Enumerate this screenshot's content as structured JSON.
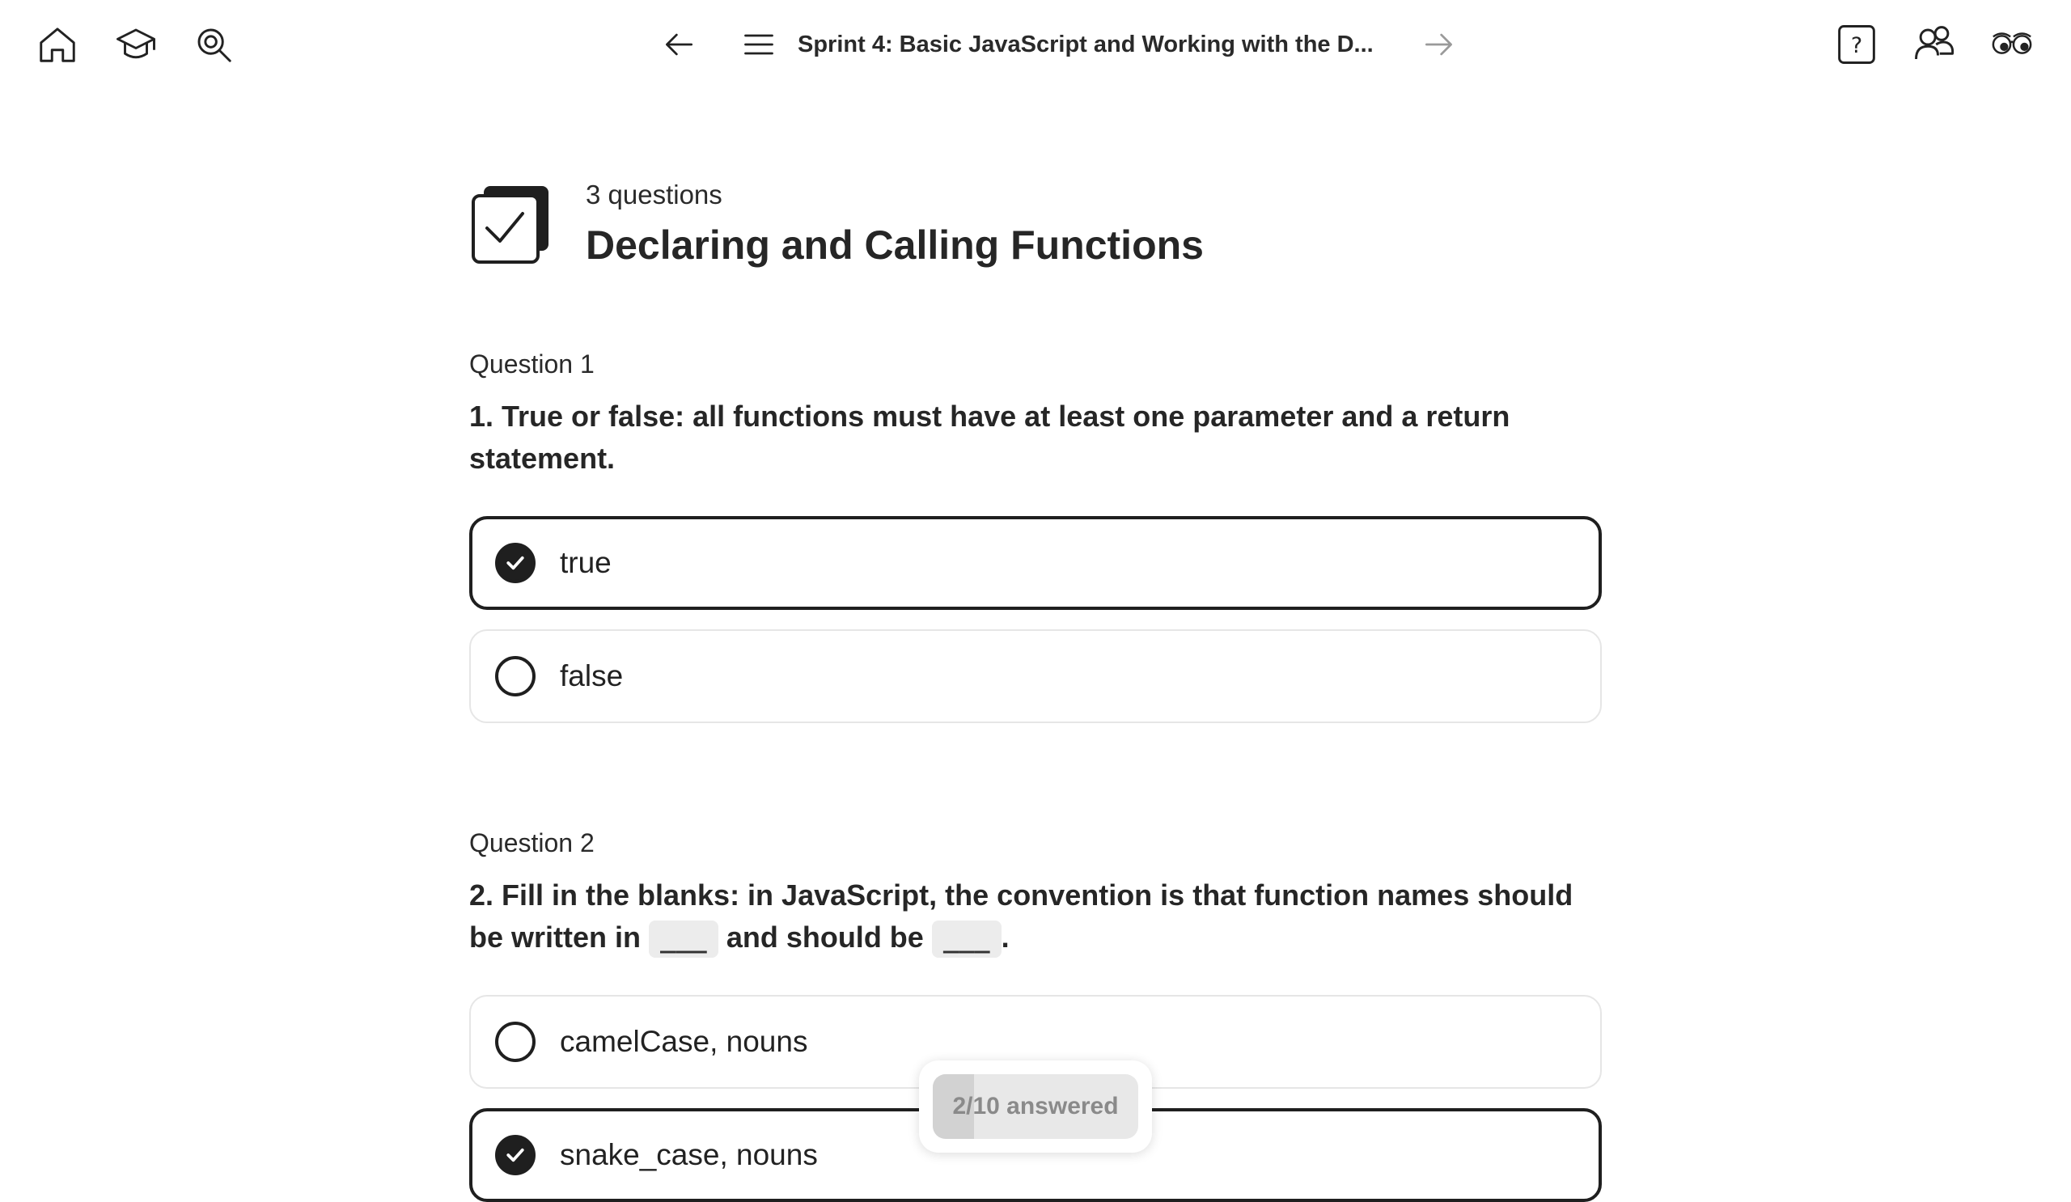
{
  "nav": {
    "title": "Sprint 4: Basic JavaScript and Working with the D..."
  },
  "quiz": {
    "question_count": "3 questions",
    "title": "Declaring and Calling Functions"
  },
  "questions": [
    {
      "label": "Question 1",
      "text": "1. True or false: all functions must have at least one parameter and a return statement.",
      "options": [
        {
          "label": "true",
          "selected": true
        },
        {
          "label": "false",
          "selected": false
        }
      ]
    },
    {
      "label": "Question 2",
      "text_parts": [
        "2. Fill in the blanks: in JavaScript, the convention is that function names should be written in ",
        "___",
        " and should be ",
        "___",
        "."
      ],
      "options": [
        {
          "label": "camelCase, nouns",
          "selected": false
        },
        {
          "label": "snake_case, nouns",
          "selected": true
        }
      ]
    }
  ],
  "progress": {
    "label": "2/10 answered",
    "fraction": 0.2
  },
  "icons": [
    "home-icon",
    "courses-icon",
    "search-icon",
    "arrow-left-icon",
    "menu-icon",
    "arrow-right-icon",
    "help-icon",
    "community-icon",
    "glasses-icon"
  ]
}
